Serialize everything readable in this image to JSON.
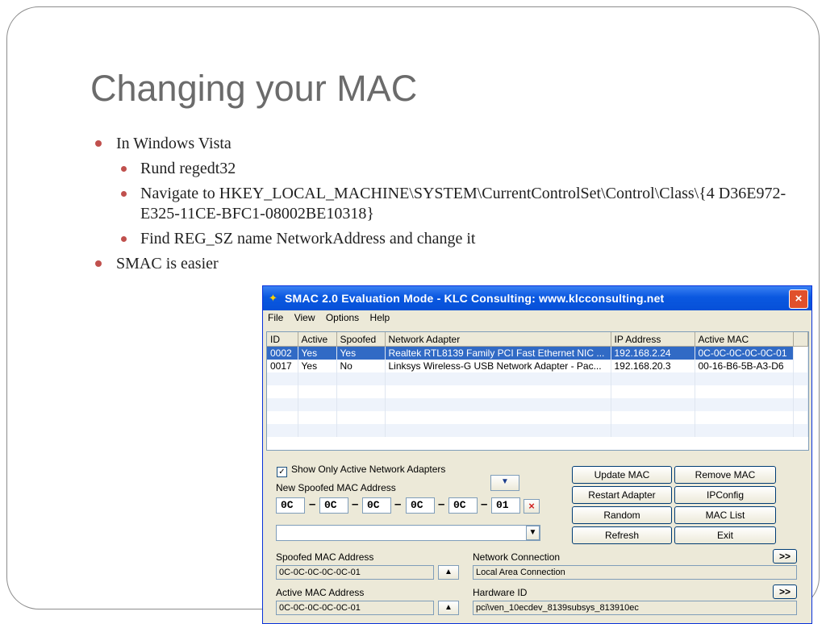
{
  "slide": {
    "title": "Changing your MAC",
    "bullets": [
      {
        "text": "In Windows Vista"
      },
      {
        "text": "Rund regedt32"
      },
      {
        "text": "Navigate to HKEY_LOCAL_MACHINE\\SYSTEM\\CurrentControlSet\\Control\\Class\\{4 D36E972-E325-11CE-BFC1-08002BE10318}"
      },
      {
        "text": "Find REG_SZ name NetworkAddress and change it"
      },
      {
        "text": "SMAC is easier"
      }
    ]
  },
  "window": {
    "title": "SMAC 2.0  Evaluation Mode  -  KLC Consulting:  www.klcconsulting.net",
    "close_label": "×",
    "menu": [
      "File",
      "View",
      "Options",
      "Help"
    ],
    "columns": [
      "ID",
      "Active",
      "Spoofed",
      "Network Adapter",
      "IP Address",
      "Active MAC"
    ],
    "rows": [
      {
        "id": "0002",
        "active": "Yes",
        "spoofed": "Yes",
        "adapter": "Realtek RTL8139 Family PCI Fast Ethernet NIC ...",
        "ip": "192.168.2.24",
        "mac": "0C-0C-0C-0C-0C-01"
      },
      {
        "id": "0017",
        "active": "Yes",
        "spoofed": "No",
        "adapter": "Linksys Wireless-G USB Network Adapter - Pac...",
        "ip": "192.168.20.3",
        "mac": "00-16-B6-5B-A3-D6"
      }
    ],
    "show_only_active_label": "Show Only Active Network Adapters",
    "new_spoofed_label": "New Spoofed MAC Address",
    "octets": [
      "0C",
      "0C",
      "0C",
      "0C",
      "0C",
      "01"
    ],
    "octet_separator": "–",
    "clear_label": "×",
    "buttons": {
      "update_mac": "Update MAC",
      "remove_mac": "Remove MAC",
      "restart_adapter": "Restart Adapter",
      "ipconfig": "IPConfig",
      "random": "Random",
      "mac_list": "MAC List",
      "refresh": "Refresh",
      "exit": "Exit",
      "expand": ">>"
    },
    "spoofed_mac_label": "Spoofed MAC Address",
    "spoofed_mac_value": "0C-0C-0C-0C-0C-01",
    "network_connection_label": "Network Connection",
    "network_connection_value": "Local Area Connection",
    "active_mac_label": "Active MAC Address",
    "active_mac_value": "0C-0C-0C-0C-0C-01",
    "hardware_id_label": "Hardware ID",
    "hardware_id_value": "pci\\ven_10ecdev_8139subsys_813910ec",
    "colors": {
      "titlebar": "#0a58e0",
      "selection": "#316ac5",
      "bullet": "#c0504d"
    },
    "icons": {
      "app": "smac-app-icon",
      "close": "close-icon",
      "dropdown": "dropdown-arrow-icon",
      "up": "up-arrow-icon"
    }
  }
}
